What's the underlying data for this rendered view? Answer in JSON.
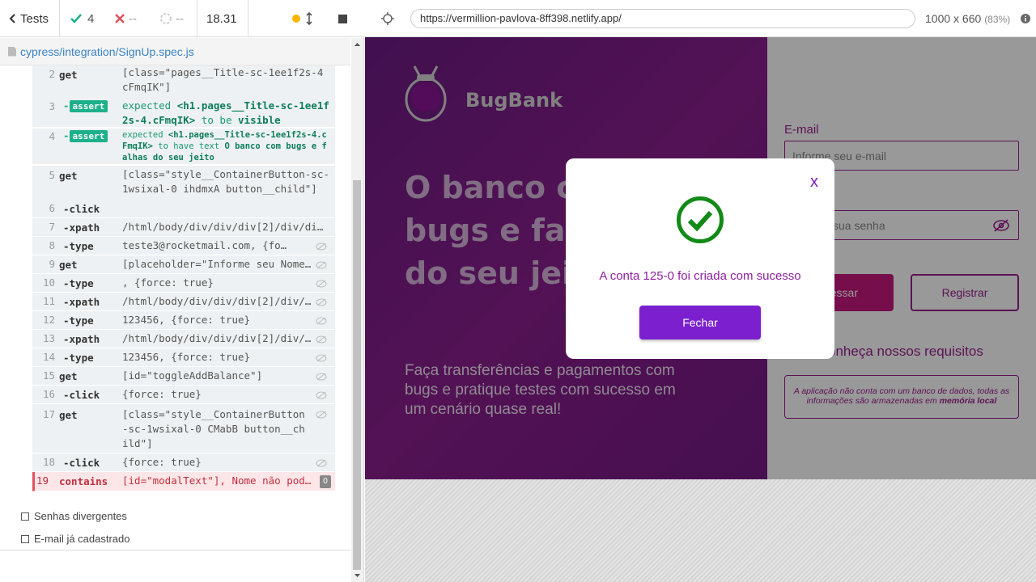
{
  "reporter": {
    "tests_label": "Tests",
    "passed": "4",
    "failed": "--",
    "pending": "--",
    "duration": "18.31",
    "spec_path": "cypress/integration/SignUp.spec.js",
    "commands": [
      {
        "n": "2",
        "name": "get",
        "msg": "[class=\"pages__Title-sc-1ee1f2s-4 cFmqIK\"]"
      },
      {
        "n": "3",
        "name": "assert",
        "msg": "expected <h1.pages__Title-sc-1ee1f2s-4.cFmqIK> to be visible"
      },
      {
        "n": "4",
        "name": "assert",
        "msg": "expected <h1.pages__Title-sc-1ee1f2s-4.cFmqIK> to have text O banco com bugs e falhas do seu jeito"
      },
      {
        "n": "5",
        "name": "get",
        "msg": "[class=\"style__ContainerButton-sc-1wsixal-0 ihdmxA button__child\"]"
      },
      {
        "n": "6",
        "name": "-click",
        "msg": ""
      },
      {
        "n": "7",
        "name": "-xpath",
        "msg": "/html/body/div/div/div[2]/div/div[…"
      },
      {
        "n": "8",
        "name": "-type",
        "msg": "teste3@rocketmail.com, {force: …"
      },
      {
        "n": "9",
        "name": "get",
        "msg": "[placeholder=\"Informe seu Nome\"]"
      },
      {
        "n": "10",
        "name": "-type",
        "msg": ", {force: true}"
      },
      {
        "n": "11",
        "name": "-xpath",
        "msg": "/html/body/div/div/div[2]/div/div[…"
      },
      {
        "n": "12",
        "name": "-type",
        "msg": "123456, {force: true}"
      },
      {
        "n": "13",
        "name": "-xpath",
        "msg": "/html/body/div/div/div[2]/div/div[…"
      },
      {
        "n": "14",
        "name": "-type",
        "msg": "123456, {force: true}"
      },
      {
        "n": "15",
        "name": "get",
        "msg": "[id=\"toggleAddBalance\"]"
      },
      {
        "n": "16",
        "name": "-click",
        "msg": "{force: true}"
      },
      {
        "n": "17",
        "name": "get",
        "msg": "[class=\"style__ContainerButton-sc-1wsixal-0 CMabB button__child\"]"
      },
      {
        "n": "18",
        "name": "-click",
        "msg": "{force: true}"
      },
      {
        "n": "19",
        "name": "contains",
        "msg": "[id=\"modalText\"], Nome não pode …",
        "badge": "0"
      }
    ],
    "assert_badge": "assert",
    "assert3_a": "expected",
    "assert3_b": "<h1.pages__Title-sc-1ee1f2s-4.cFmqIK>",
    "assert3_c": "to be",
    "assert3_d": "visible",
    "assert4_a": "expected",
    "assert4_b": "<h1.pages__Title-sc-1ee1f2s-4.cFmqIK>",
    "assert4_c": "to have text",
    "assert4_d": "O banco com bugs e falhas do seu jeito",
    "tests": [
      "Senhas divergentes",
      "E-mail já cadastrado"
    ]
  },
  "aut": {
    "url": "https://vermillion-pavlova-8ff398.netlify.app/",
    "viewport": "1000 x 660",
    "scale": "(83%)",
    "logo_text": "BugBank",
    "headline": "O banco c\nbugs e fal\ndo seu jei",
    "subline": "Faça transferências e pagamentos com bugs e pratique testes com sucesso em um cenário quase real!",
    "email_label": "E-mail",
    "email_placeholder": "Informe seu e-mail",
    "password_placeholder": "sua senha",
    "access_button": "essar",
    "register_button": "Registrar",
    "requirements_link": "onheça nossos requisitos",
    "notice_a": "A aplicação não conta com um banco de dados, todas as informações são armazenadas em",
    "notice_b": "memória local"
  },
  "modal": {
    "close": "x",
    "text": "A conta 125-0 foi criada com sucesso",
    "button": "Fechar"
  },
  "colors": {
    "pass": "#1cb08b",
    "fail": "#e05260",
    "brand": "#7b1fcf"
  }
}
